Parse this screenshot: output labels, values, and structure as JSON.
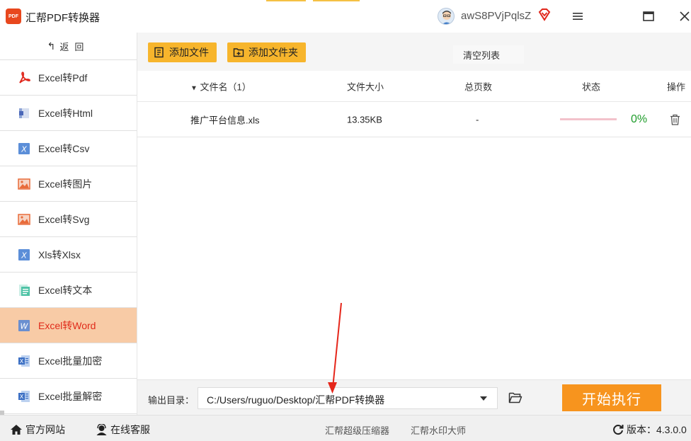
{
  "titlebar": {
    "title": "汇帮PDF转换器",
    "logo_text": "PDF",
    "username": "awS8PVjPqlsZ",
    "menu_icon": "hamburger-icon",
    "maximize_icon": "maximize-icon",
    "close_icon": "close-icon"
  },
  "sidebar": {
    "back_label": "返回",
    "items": [
      {
        "label": "Excel转Pdf",
        "icon": "pdf-icon"
      },
      {
        "label": "Excel转Html",
        "icon": "html-icon"
      },
      {
        "label": "Excel转Csv",
        "icon": "csv-icon"
      },
      {
        "label": "Excel转图片",
        "icon": "image-icon"
      },
      {
        "label": "Excel转Svg",
        "icon": "svg-icon"
      },
      {
        "label": "Xls转Xlsx",
        "icon": "xlsx-icon"
      },
      {
        "label": "Excel转文本",
        "icon": "text-icon"
      },
      {
        "label": "Excel转Word",
        "icon": "word-icon",
        "active": true
      },
      {
        "label": "Excel批量加密",
        "icon": "encrypt-icon"
      },
      {
        "label": "Excel批量解密",
        "icon": "decrypt-icon"
      }
    ]
  },
  "toolbar": {
    "add_file": "添加文件",
    "add_folder": "添加文件夹",
    "clear_list": "清空列表"
  },
  "table": {
    "headers": {
      "filename": "文件名（1）",
      "size": "文件大小",
      "pages": "总页数",
      "status": "状态",
      "action": "操作"
    },
    "rows": [
      {
        "filename": "推广平台信息.xls",
        "size": "13.35KB",
        "pages": "-",
        "progress": 0,
        "status": "0%"
      }
    ]
  },
  "output": {
    "label": "输出目录：",
    "path": "C:/Users/ruguo/Desktop/汇帮PDF转换器",
    "start": "开始执行"
  },
  "statusbar": {
    "website": "官方网站",
    "service": "在线客服",
    "link1": "汇帮超级压缩器",
    "link2": "汇帮水印大师",
    "version_label": "版本：",
    "version": "4.3.0.0"
  },
  "colors": {
    "accent": "#f7b52c",
    "start": "#f7941e",
    "active_bg": "#f8cba6",
    "active_text": "#e02b1a",
    "progress_green": "#1e9c2a",
    "arrow_red": "#e5261a"
  }
}
